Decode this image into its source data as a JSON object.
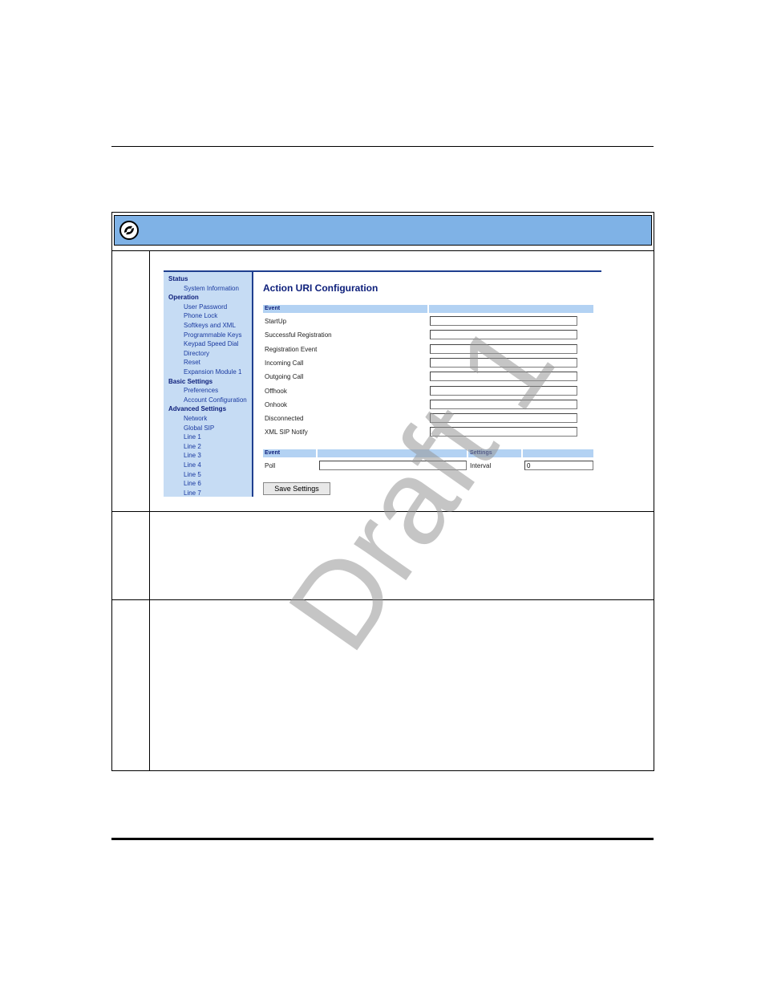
{
  "sidebar": {
    "items": [
      {
        "type": "section",
        "label": "Status"
      },
      {
        "type": "item",
        "label": "System Information"
      },
      {
        "type": "section",
        "label": "Operation"
      },
      {
        "type": "item",
        "label": "User Password"
      },
      {
        "type": "item",
        "label": "Phone Lock"
      },
      {
        "type": "item",
        "label": "Softkeys and XML"
      },
      {
        "type": "item",
        "label": "Programmable Keys"
      },
      {
        "type": "item",
        "label": "Keypad Speed Dial"
      },
      {
        "type": "item",
        "label": "Directory"
      },
      {
        "type": "item",
        "label": "Reset"
      },
      {
        "type": "item",
        "label": "Expansion Module 1"
      },
      {
        "type": "section",
        "label": "Basic Settings"
      },
      {
        "type": "item",
        "label": "Preferences"
      },
      {
        "type": "item",
        "label": "Account Configuration"
      },
      {
        "type": "section",
        "label": "Advanced Settings"
      },
      {
        "type": "item",
        "label": "Network"
      },
      {
        "type": "item",
        "label": "Global SIP"
      },
      {
        "type": "item",
        "label": "Line 1"
      },
      {
        "type": "item",
        "label": "Line 2"
      },
      {
        "type": "item",
        "label": "Line 3"
      },
      {
        "type": "item",
        "label": "Line 4"
      },
      {
        "type": "item",
        "label": "Line 5"
      },
      {
        "type": "item",
        "label": "Line 6"
      },
      {
        "type": "item",
        "label": "Line 7"
      }
    ]
  },
  "main": {
    "title": "Action URI Configuration",
    "event_header": "Event",
    "fields": [
      {
        "label": "StartUp",
        "value": ""
      },
      {
        "label": "Successful Registration",
        "value": ""
      },
      {
        "label": "Registration Event",
        "value": ""
      },
      {
        "label": "Incoming Call",
        "value": ""
      },
      {
        "label": "Outgoing Call",
        "value": ""
      },
      {
        "label": "Offhook",
        "value": ""
      },
      {
        "label": "Onhook",
        "value": ""
      },
      {
        "label": "Disconnected",
        "value": ""
      },
      {
        "label": "XML SIP Notify",
        "value": ""
      }
    ],
    "poll_section": {
      "event_header": "Event",
      "settings_header": "Settings",
      "poll_label": "Poll",
      "poll_value": "",
      "interval_label": "Interval",
      "interval_value": "0"
    },
    "save_label": "Save Settings"
  },
  "watermark": "Draft 1",
  "colors": {
    "header_bar": "#7fb2e6",
    "sidebar_bg": "#c6dcf4",
    "band": "#b3d2f3",
    "nav_text": "#1a3aa0"
  }
}
